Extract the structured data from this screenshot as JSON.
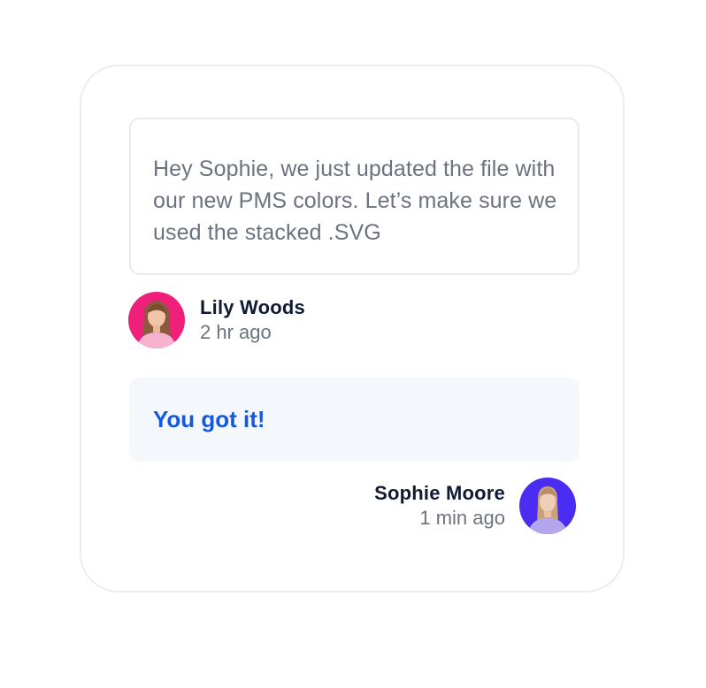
{
  "conversation": {
    "incoming": {
      "text": "Hey Sophie, we just updated the file with our new PMS colors. Let’s make sure we used the stacked .SVG",
      "author": "Lily Woods",
      "time": "2 hr ago",
      "avatar_color": "#ef1f7a"
    },
    "outgoing": {
      "text": "You got it!",
      "author": "Sophie Moore",
      "time": "1 min ago",
      "avatar_color": "#4a2cf2",
      "text_color": "#1558e0"
    }
  }
}
